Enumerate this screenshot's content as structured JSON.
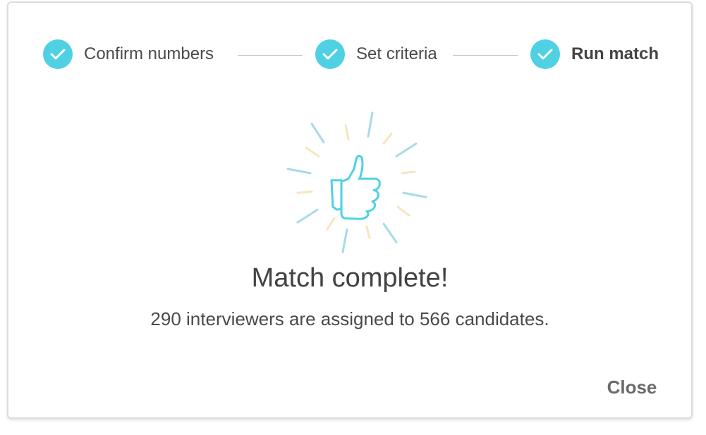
{
  "stepper": {
    "steps": [
      {
        "label": "Confirm numbers",
        "icon": "check-icon",
        "state": "complete"
      },
      {
        "label": "Set criteria",
        "icon": "check-icon",
        "state": "complete"
      },
      {
        "label": "Run match",
        "icon": "check-icon",
        "state": "current"
      }
    ]
  },
  "illustration": {
    "icon": "thumbs-up-icon"
  },
  "message": {
    "title": "Match complete!",
    "body": "290 interviewers are assigned to 566 candidates."
  },
  "actions": {
    "close_label": "Close"
  },
  "colors": {
    "accent": "#4fd1e3",
    "ray_blue": "#a7dbe8",
    "ray_yellow": "#f6e5bf",
    "text": "#4a4a4a"
  }
}
